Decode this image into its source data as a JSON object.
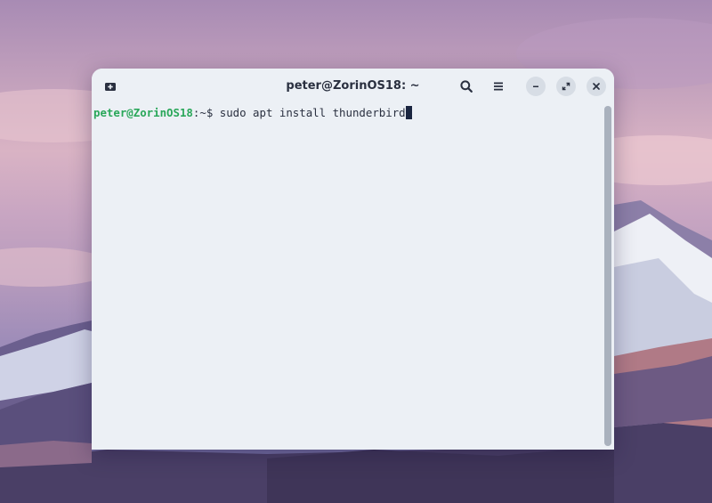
{
  "window": {
    "title": "peter@ZorinOS18: ~"
  },
  "titlebar": {
    "new_tab_icon": "new-tab-icon",
    "search_icon": "search-icon",
    "menu_icon": "hamburger-menu-icon",
    "minimize_icon": "minimize-icon",
    "maximize_icon": "maximize-icon",
    "close_icon": "close-icon"
  },
  "terminal": {
    "prompt_user_host": "peter@ZorinOS18",
    "prompt_path": ":~$ ",
    "command": "sudo apt install thunderbird"
  },
  "colors": {
    "terminal_bg": "#ecf0f5",
    "prompt_user": "#2aa75a",
    "text": "#2a3040"
  }
}
